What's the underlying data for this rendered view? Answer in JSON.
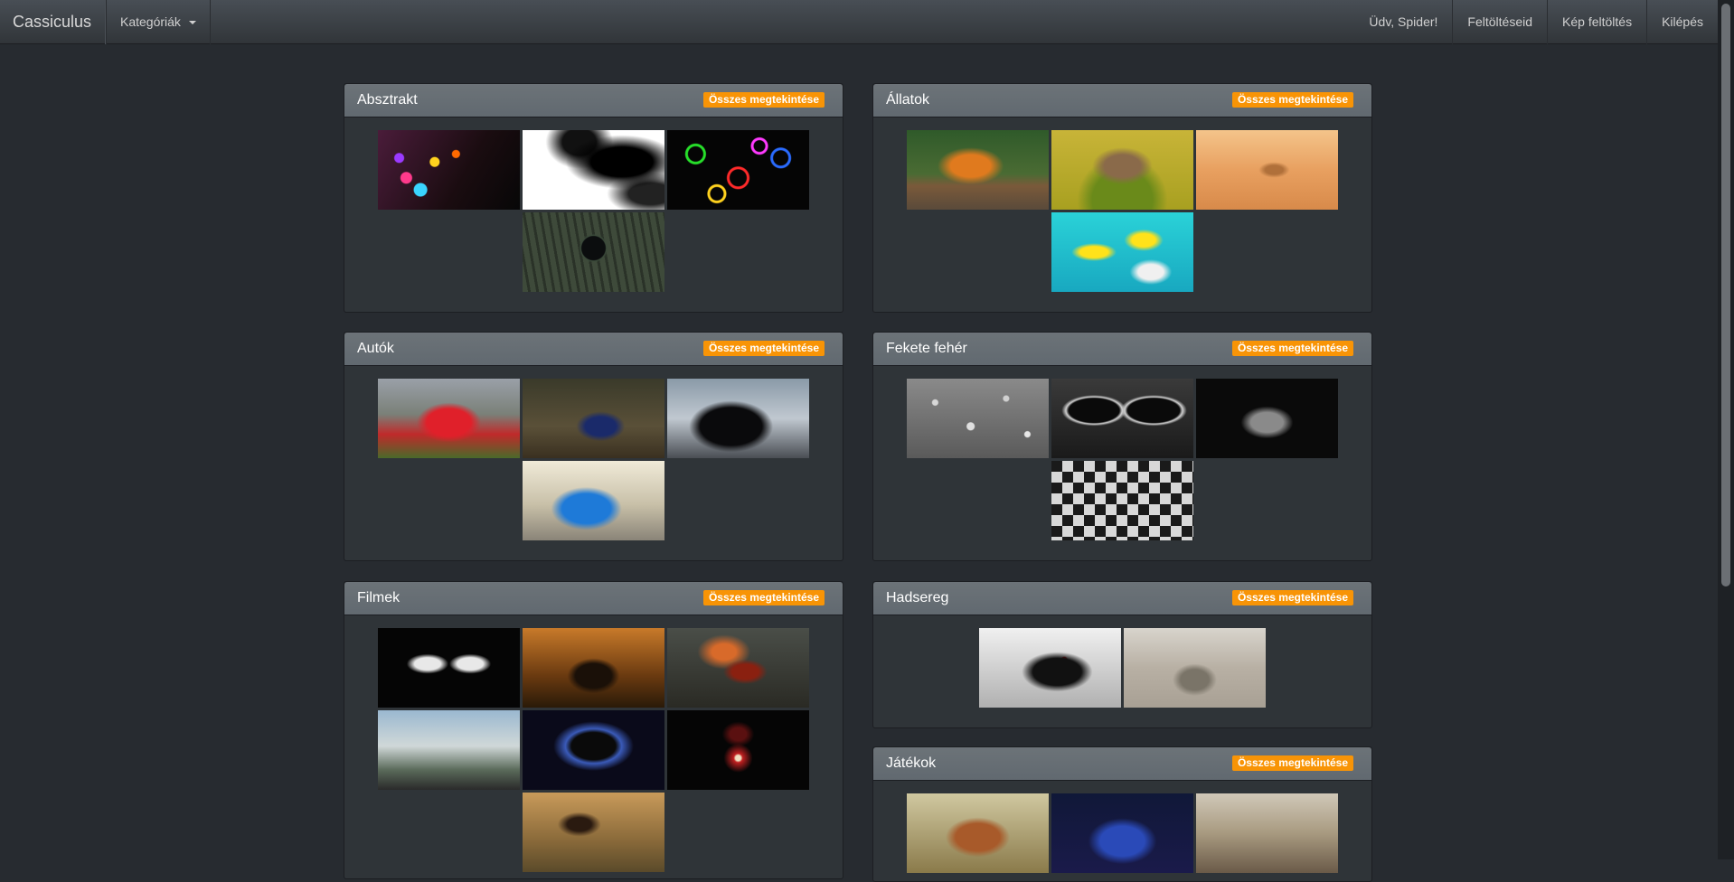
{
  "navbar": {
    "brand": "Cassiculus",
    "categories_label": "Kategóriák",
    "greeting": "Üdv, Spider!",
    "my_uploads": "Feltöltéseid",
    "upload_image": "Kép feltöltés",
    "logout": "Kilépés"
  },
  "view_all_label": "Összes megtekintése",
  "panels": [
    {
      "title": "Absztrakt",
      "images": [
        "colorful-dots",
        "ink-smoke",
        "neon-rings",
        "glass-sphere"
      ]
    },
    {
      "title": "Állatok",
      "images": [
        "tiger",
        "owl",
        "desert-fox",
        "tropical-fish"
      ]
    },
    {
      "title": "Autók",
      "images": [
        "red-camaro",
        "blue-subaru",
        "black-bmw",
        "blue-ford-focus"
      ]
    },
    {
      "title": "Fekete fehér",
      "images": [
        "water-drops",
        "sunglasses",
        "horned-skull",
        "chess-pieces"
      ]
    },
    {
      "title": "Filmek",
      "images": [
        "pulp-fiction",
        "batman",
        "iron-man-fire",
        "oblivion",
        "darth-vader",
        "iron-man-dark",
        "dragon-castle"
      ]
    },
    {
      "title": "Hadsereg",
      "images": [
        "sniper",
        "soldiers-desert"
      ]
    },
    {
      "title": "Játékok",
      "images": [
        "warcraft-orc",
        "fantasy-blue",
        "rocky-canyon"
      ]
    }
  ]
}
